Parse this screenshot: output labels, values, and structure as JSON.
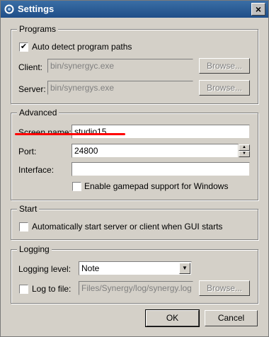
{
  "window": {
    "title": "Settings"
  },
  "programs": {
    "legend": "Programs",
    "auto_detect": {
      "label": "Auto detect program paths",
      "checked": true,
      "mark": "✔"
    },
    "client": {
      "label": "Client:",
      "value": "bin/synergyc.exe",
      "browse": "Browse..."
    },
    "server": {
      "label": "Server:",
      "value": "bin/synergys.exe",
      "browse": "Browse..."
    }
  },
  "advanced": {
    "legend": "Advanced",
    "screen_name": {
      "label": "Screen name:",
      "value": "studio15"
    },
    "port": {
      "label": "Port:",
      "value": "24800"
    },
    "interface": {
      "label": "Interface:",
      "value": ""
    },
    "gamepad": {
      "label": "Enable gamepad support for Windows",
      "checked": false
    }
  },
  "start": {
    "legend": "Start",
    "auto_start": {
      "label": "Automatically start server or client when GUI starts",
      "checked": false
    }
  },
  "logging": {
    "legend": "Logging",
    "level": {
      "label": "Logging level:",
      "value": "Note"
    },
    "log_to_file": {
      "label": "Log to file:",
      "checked": false,
      "value": "Files/Synergy/log/synergy.log",
      "browse": "Browse..."
    }
  },
  "buttons": {
    "ok": "OK",
    "cancel": "Cancel"
  },
  "colors": {
    "annotation": "#ff0000"
  },
  "icons": {
    "app": "synergy-ring-icon",
    "close": "close-icon",
    "dropdown": "chevron-down-icon",
    "spin_up": "spin-up-icon",
    "spin_down": "spin-down-icon"
  }
}
